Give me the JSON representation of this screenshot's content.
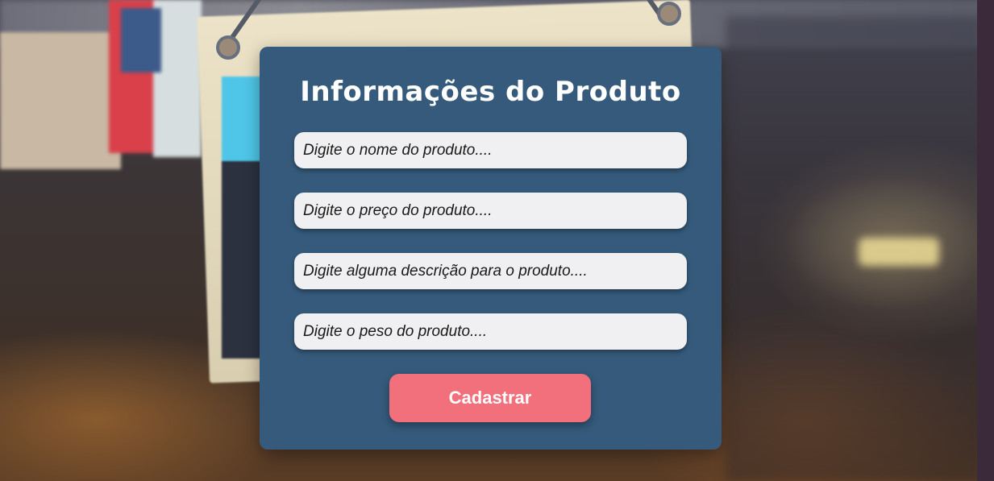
{
  "form": {
    "title": "Informações do Produto",
    "fields": [
      {
        "name": "nome",
        "placeholder": "Digite o nome do produto....",
        "value": ""
      },
      {
        "name": "preco",
        "placeholder": "Digite o preço do produto....",
        "value": ""
      },
      {
        "name": "descricao",
        "placeholder": "Digite alguma descrição para o produto....",
        "value": ""
      },
      {
        "name": "peso",
        "placeholder": "Digite o peso do produto....",
        "value": ""
      }
    ],
    "submit_label": "Cadastrar"
  },
  "colors": {
    "card_background": "#355a7b",
    "input_background": "#f0f0f2",
    "button_background": "#f26f7c",
    "title_text": "#ffffff"
  }
}
